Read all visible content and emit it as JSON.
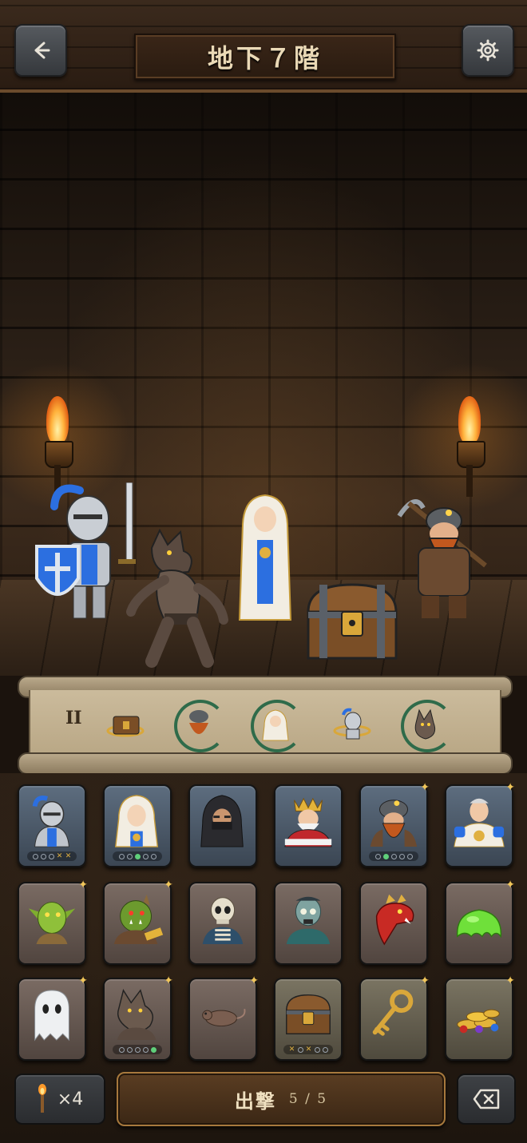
{
  "header": {
    "title": "地下７階",
    "back_icon": "arrow-left-icon",
    "settings_icon": "gear-icon"
  },
  "scene": {
    "characters": [
      "knight",
      "werewolf",
      "nun",
      "treasure-chest",
      "dwarf-miner"
    ]
  },
  "queue": {
    "round_label": "II",
    "items": [
      {
        "name": "treasure-chest",
        "ring": "gold"
      },
      {
        "name": "dwarf-miner",
        "ring": "green"
      },
      {
        "name": "nun",
        "ring": "green"
      },
      {
        "name": "knight",
        "ring": "gold"
      },
      {
        "name": "werewolf",
        "ring": "green"
      }
    ]
  },
  "cards": [
    {
      "name": "knight",
      "kind": "hero",
      "dots": [
        "o",
        "o",
        "o",
        "x",
        "x"
      ],
      "sparkle": false
    },
    {
      "name": "nun",
      "kind": "hero",
      "dots": [
        "o",
        "o",
        "on",
        "o",
        "o"
      ],
      "sparkle": false
    },
    {
      "name": "hooded-rogue",
      "kind": "hero",
      "dots": [],
      "sparkle": false
    },
    {
      "name": "king",
      "kind": "hero",
      "dots": [],
      "sparkle": false
    },
    {
      "name": "dwarf-miner",
      "kind": "hero",
      "dots": [
        "o",
        "on",
        "o",
        "o",
        "o"
      ],
      "sparkle": true
    },
    {
      "name": "paladin",
      "kind": "hero",
      "dots": [],
      "sparkle": true
    },
    {
      "name": "goblin",
      "kind": "monster",
      "dots": [],
      "sparkle": true
    },
    {
      "name": "orc",
      "kind": "monster",
      "dots": [],
      "sparkle": true
    },
    {
      "name": "skeleton",
      "kind": "monster",
      "dots": [],
      "sparkle": false
    },
    {
      "name": "zombie",
      "kind": "monster",
      "dots": [],
      "sparkle": false
    },
    {
      "name": "red-dragon",
      "kind": "monster",
      "dots": [],
      "sparkle": false
    },
    {
      "name": "green-slime",
      "kind": "monster",
      "dots": [],
      "sparkle": true
    },
    {
      "name": "ghost",
      "kind": "monster",
      "dots": [],
      "sparkle": true
    },
    {
      "name": "werewolf",
      "kind": "monster",
      "dots": [
        "o",
        "o",
        "o",
        "o",
        "on"
      ],
      "sparkle": true
    },
    {
      "name": "rat",
      "kind": "monster",
      "dots": [],
      "sparkle": true
    },
    {
      "name": "treasure-chest",
      "kind": "item",
      "dots": [
        "x",
        "o",
        "x",
        "o",
        "o"
      ],
      "sparkle": false
    },
    {
      "name": "golden-key",
      "kind": "item",
      "dots": [],
      "sparkle": true
    },
    {
      "name": "gold-and-gems",
      "kind": "item",
      "dots": [],
      "sparkle": true
    }
  ],
  "bottom": {
    "torch_icon": "torch-icon",
    "torch_count": "×4",
    "sortie_label": "出撃",
    "sortie_count": "5 / 5",
    "delete_icon": "backspace-icon"
  },
  "colors": {
    "accent_gold": "#f1c65a",
    "ring_green": "#2f6b4a",
    "hero_card": "#5d6d7f",
    "monster_card": "#7a6b63",
    "item_card": "#7a7462"
  }
}
